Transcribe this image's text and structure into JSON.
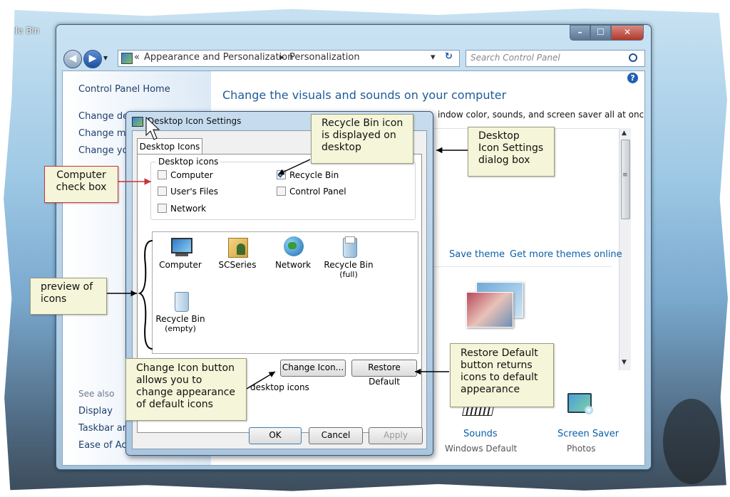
{
  "desktop": {
    "recycle_label": "ycle Bin"
  },
  "window": {
    "caption_buttons": {
      "minimize": "–",
      "maximize": "☐",
      "close": "✕"
    },
    "nav": {
      "back": "◀",
      "forward": "▶",
      "history": "▾",
      "breadcrumb_prefix": "«",
      "breadcrumb": [
        "Appearance and Personalization",
        "Personalization"
      ],
      "crumb_sep": "▸",
      "dropdown": "▾",
      "refresh": "↻",
      "search_placeholder": "Search Control Panel",
      "search_icon": "magnifier-icon"
    },
    "help": "?",
    "left_pane": {
      "home": "Control Panel Home",
      "links": [
        "Change de",
        "Change m",
        "Change yo"
      ],
      "see_also": "See also",
      "see_also_links": [
        "Display",
        "Taskbar an",
        "Ease of Ac"
      ]
    },
    "main": {
      "title": "Change the visuals and sounds on your computer",
      "subtitle_tail": "indow color, sounds, and screen saver all at once.",
      "save_theme": "Save theme",
      "get_more": "Get more themes online",
      "sounds": {
        "label": "Sounds",
        "value": "Windows Default"
      },
      "screensaver": {
        "label": "Screen Saver",
        "value": "Photos"
      },
      "scroll_up": "▲",
      "scroll_down": "▼",
      "scroll_grip": "≡"
    }
  },
  "dialog": {
    "title": "Desktop Icon Settings",
    "tab": "Desktop Icons",
    "group_label": "Desktop icons",
    "checkboxes": [
      {
        "label": "Computer",
        "checked": false
      },
      {
        "label": "User's Files",
        "checked": false
      },
      {
        "label": "Network",
        "checked": false
      },
      {
        "label": "Recycle Bin",
        "checked": true
      },
      {
        "label": "Control Panel",
        "checked": false
      }
    ],
    "preview_icons": [
      {
        "label": "Computer",
        "icon": "computer-icon"
      },
      {
        "label": "SCSeries",
        "icon": "user-folder-icon"
      },
      {
        "label": "Network",
        "icon": "network-globe-icon"
      },
      {
        "label": "Recycle Bin (full)",
        "line1": "Recycle Bin",
        "line2": "(full)",
        "icon": "recycle-bin-full-icon"
      },
      {
        "label": "Recycle Bin (empty)",
        "line1": "Recycle Bin",
        "line2": "(empty)",
        "icon": "recycle-bin-empty-icon"
      }
    ],
    "change_icon": "Change Icon...",
    "restore_default": "Restore Default",
    "allow_themes_tail": "desktop icons",
    "ok": "OK",
    "cancel": "Cancel",
    "apply": "Apply"
  },
  "callouts": {
    "computer_cb": [
      "Computer",
      "check box"
    ],
    "recycle": [
      "Recycle Bin icon",
      "is displayed on",
      "desktop"
    ],
    "dialog_box": [
      "Desktop",
      "Icon Settings",
      "dialog box"
    ],
    "preview": [
      "preview of",
      "icons"
    ],
    "change_icon": [
      "Change Icon button",
      "allows you to",
      "change appearance",
      "of default icons"
    ],
    "restore": [
      "Restore Default",
      "button returns",
      "icons to default",
      "appearance"
    ]
  },
  "colors": {
    "link": "#0a5fa8",
    "callout_bg": "#f5f5d9",
    "callout_red_border": "#c8353a",
    "title_blue": "#1e5b9b"
  }
}
